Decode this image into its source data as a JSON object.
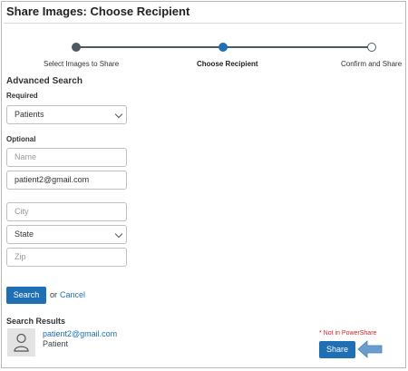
{
  "window": {
    "title": "Share Images: Choose Recipient"
  },
  "stepper": {
    "steps": [
      {
        "label": "Select Images to Share",
        "state": "completed"
      },
      {
        "label": "Choose Recipient",
        "state": "active"
      },
      {
        "label": "Confirm and Share",
        "state": "pending"
      }
    ],
    "colors": {
      "completed": "#4f5a60",
      "active": "#1e6fb3",
      "pending": "#ffffff"
    }
  },
  "advanced_search": {
    "heading": "Advanced Search",
    "required_label": "Required",
    "recipient_type": {
      "value": "Patients"
    },
    "optional_label": "Optional",
    "name": {
      "value": "",
      "placeholder": "Name"
    },
    "email": {
      "value": "patient2@gmail.com",
      "placeholder": ""
    },
    "city": {
      "value": "",
      "placeholder": "City"
    },
    "state": {
      "value": "State"
    },
    "zip": {
      "value": "",
      "placeholder": "Zip"
    },
    "search_button": "Search",
    "or_text": "or",
    "cancel_link": "Cancel"
  },
  "search_results": {
    "heading": "Search Results",
    "items": [
      {
        "email": "patient2@gmail.com",
        "type": "Patient",
        "note": "* Not in PowerShare",
        "share_button": "Share",
        "icon": "person-icon"
      }
    ]
  },
  "colors": {
    "accent": "#1e6fb3",
    "warning": "#d2232a",
    "arrow": "#6a9ecf"
  }
}
